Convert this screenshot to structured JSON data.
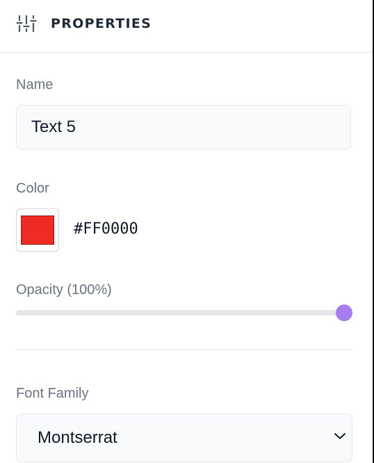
{
  "header": {
    "title": "PROPERTIES",
    "icon": "sliders-icon"
  },
  "name": {
    "label": "Name",
    "value": "Text 5"
  },
  "color": {
    "label": "Color",
    "swatch": "#EE2B24",
    "hex": "#FF0000"
  },
  "opacity": {
    "label": "Opacity (100%)",
    "value_percent": 100,
    "thumb_color": "#A77EF0"
  },
  "font_family": {
    "label": "Font Family",
    "selected": "Montserrat",
    "icon": "chevron-down-icon"
  }
}
